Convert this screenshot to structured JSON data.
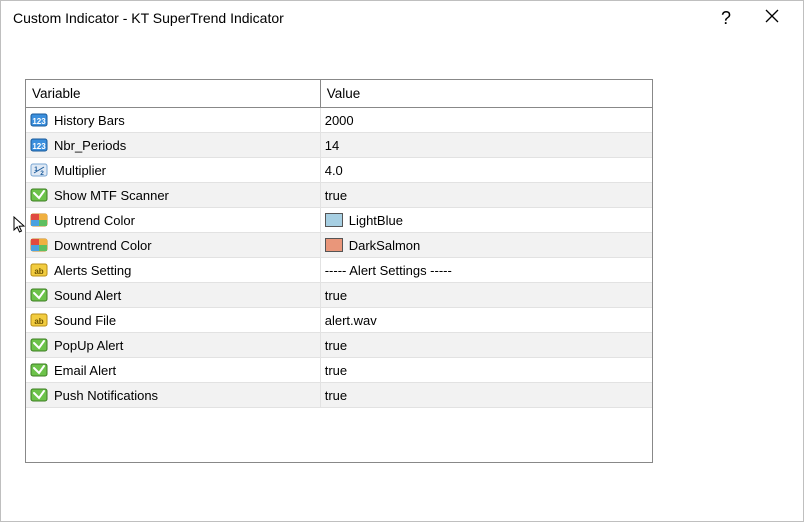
{
  "window": {
    "title": "Custom Indicator - KT SuperTrend Indicator"
  },
  "table": {
    "headers": {
      "variable": "Variable",
      "value": "Value"
    },
    "rows": [
      {
        "icon": "number-icon",
        "label": "History Bars",
        "value": "2000"
      },
      {
        "icon": "number-icon",
        "label": "Nbr_Periods",
        "value": "14"
      },
      {
        "icon": "fraction-icon",
        "label": "Multiplier",
        "value": "4.0"
      },
      {
        "icon": "bool-icon",
        "label": "Show MTF Scanner",
        "value": "true"
      },
      {
        "icon": "color-icon",
        "label": "Uptrend Color",
        "value": "LightBlue",
        "swatch": "#a7cfe2"
      },
      {
        "icon": "color-icon",
        "label": "Downtrend Color",
        "value": "DarkSalmon",
        "swatch": "#e9967a"
      },
      {
        "icon": "string-icon",
        "label": "Alerts Setting",
        "value": "----- Alert Settings -----"
      },
      {
        "icon": "bool-icon",
        "label": "Sound Alert",
        "value": "true"
      },
      {
        "icon": "string-icon",
        "label": "Sound File",
        "value": "alert.wav"
      },
      {
        "icon": "bool-icon",
        "label": "PopUp Alert",
        "value": "true"
      },
      {
        "icon": "bool-icon",
        "label": "Email Alert",
        "value": "true"
      },
      {
        "icon": "bool-icon",
        "label": "Push Notifications",
        "value": "true"
      }
    ]
  }
}
